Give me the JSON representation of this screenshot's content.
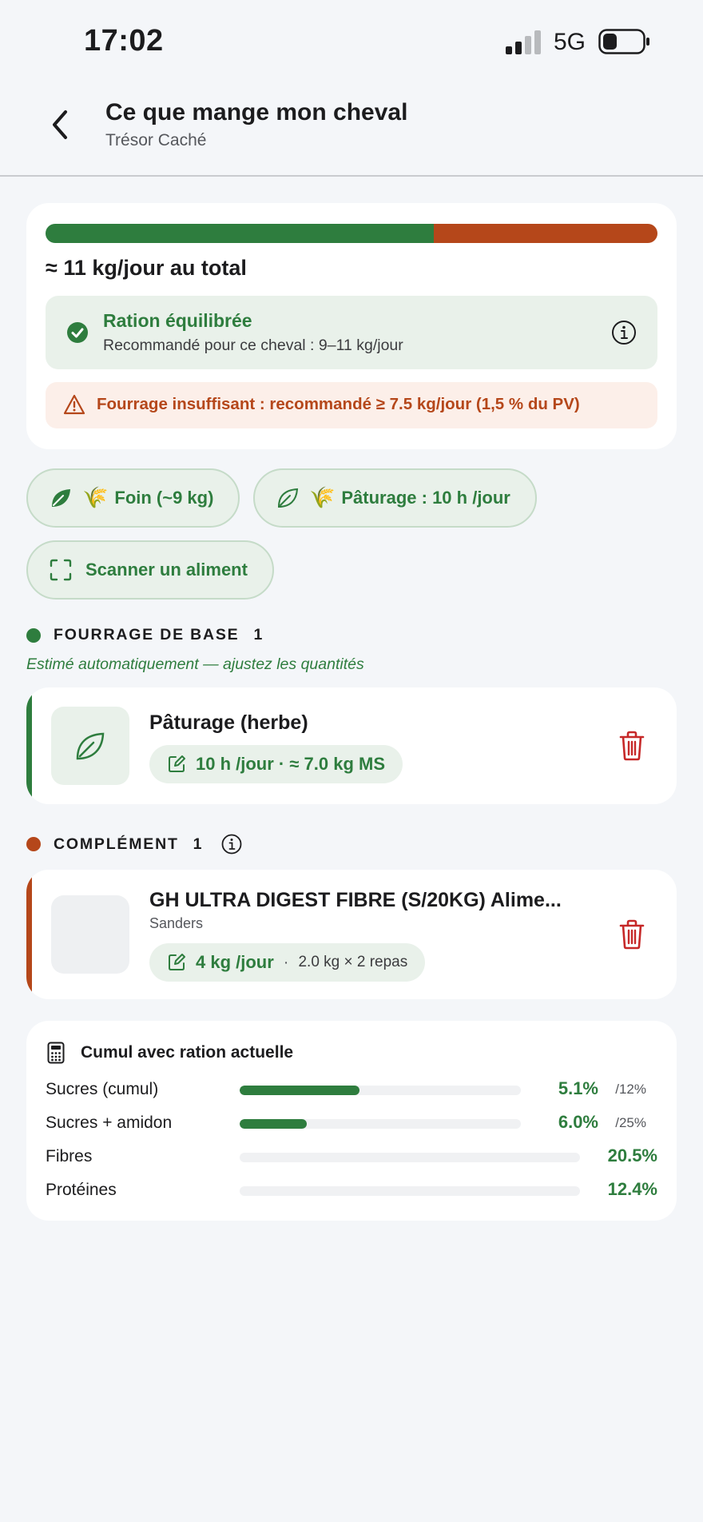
{
  "status_bar": {
    "time": "17:02",
    "network": "5G"
  },
  "header": {
    "title": "Ce que mange mon cheval",
    "subtitle": "Trésor Caché"
  },
  "ration": {
    "bar": {
      "forage_fraction": 0.635,
      "complement_fraction": 0.365,
      "forage_color": "#2e7d3e",
      "complement_color": "#b5471a"
    },
    "total_label": "≈ 11 kg/jour au total",
    "status_title": "Ration équilibrée",
    "status_desc": "Recommandé pour ce cheval : 9–11 kg/jour",
    "warning": "Fourrage insuffisant : recommandé ≥ 7.5 kg/jour (1,5 % du PV)"
  },
  "chips": {
    "hay": "Foin (~9 kg)",
    "pasture": "Pâturage : 10 h /jour",
    "wheat_glyph": "🌾",
    "scan": "Scanner un aliment"
  },
  "sections": {
    "forage": {
      "label": "FOURRAGE DE BASE",
      "count": "1",
      "color": "#2e7d3e",
      "note": "Estimé automatiquement — ajustez les quantités"
    },
    "complement": {
      "label": "COMPLÉMENT",
      "count": "1",
      "color": "#b5471a"
    }
  },
  "items": {
    "pasture": {
      "name": "Pâturage (herbe)",
      "qty": "10 h /jour · ≈ 7.0 kg MS"
    },
    "complement": {
      "name": "GH ULTRA DIGEST FIBRE (S/20KG) Alime...",
      "brand": "Sanders",
      "qty": "4 kg /jour",
      "separator": "·",
      "detail": "2.0 kg × 2 repas"
    }
  },
  "cumul": {
    "title": "Cumul avec ration actuelle",
    "rows": [
      {
        "label": "Sucres (cumul)",
        "value": "5.1%",
        "max": "/12%",
        "fill": 0.425
      },
      {
        "label": "Sucres + amidon",
        "value": "6.0%",
        "max": "/25%",
        "fill": 0.24
      },
      {
        "label": "Fibres",
        "value": "20.5%",
        "max": "",
        "fill": 0
      },
      {
        "label": "Protéines",
        "value": "12.4%",
        "max": "",
        "fill": 0
      }
    ]
  }
}
